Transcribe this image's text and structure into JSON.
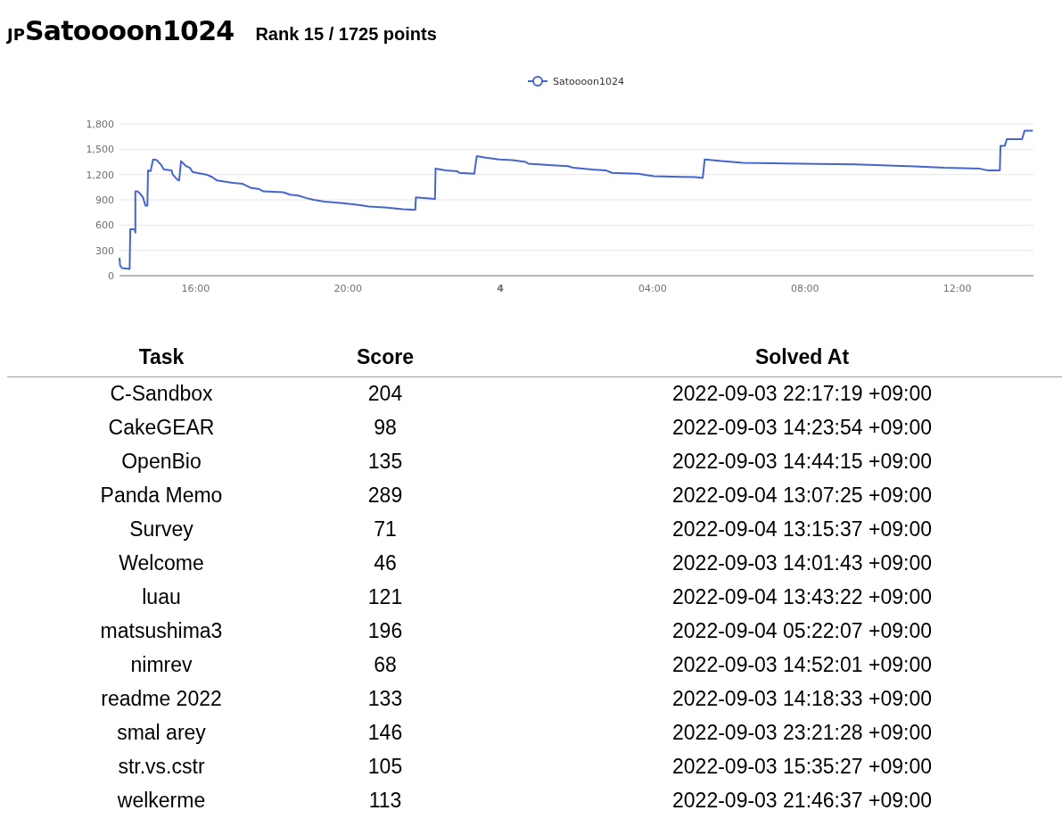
{
  "header": {
    "country": "JP",
    "username": "Satoooon1024",
    "rank": "Rank 15 / 1725 points"
  },
  "chart": {
    "chart_data": {
      "type": "line",
      "grid": true,
      "xlim": [
        "2022-09-03T14:00",
        "2022-09-04T14:00"
      ],
      "ylim": [
        0,
        1800
      ],
      "xticks": [
        {
          "value": "2022-09-03T16:00",
          "label": "16:00"
        },
        {
          "value": "2022-09-03T20:00",
          "label": "20:00"
        },
        {
          "value": "2022-09-04T00:00",
          "label": "4"
        },
        {
          "value": "2022-09-04T04:00",
          "label": "04:00"
        },
        {
          "value": "2022-09-04T08:00",
          "label": "08:00"
        },
        {
          "value": "2022-09-04T12:00",
          "label": "12:00"
        }
      ],
      "yticks": [
        {
          "value": 0,
          "label": "0"
        },
        {
          "value": 300,
          "label": "300"
        },
        {
          "value": 600,
          "label": "600"
        },
        {
          "value": 900,
          "label": "900"
        },
        {
          "value": 1200,
          "label": "1,200"
        },
        {
          "value": 1500,
          "label": "1,500"
        },
        {
          "value": 1800,
          "label": "1,800"
        }
      ],
      "x": [
        "2022-09-03T14:00",
        "2022-09-03T14:01",
        "2022-09-03T14:04",
        "2022-09-03T14:16",
        "2022-09-03T14:17",
        "2022-09-03T14:24",
        "2022-09-03T14:25",
        "2022-09-03T14:25",
        "2022-09-03T14:29",
        "2022-09-03T14:34",
        "2022-09-03T14:37",
        "2022-09-03T14:41",
        "2022-09-03T14:44",
        "2022-09-03T14:45",
        "2022-09-03T14:49",
        "2022-09-03T14:53",
        "2022-09-03T14:59",
        "2022-09-03T15:05",
        "2022-09-03T15:10",
        "2022-09-03T15:22",
        "2022-09-03T15:24",
        "2022-09-03T15:31",
        "2022-09-03T15:34",
        "2022-09-03T15:37",
        "2022-09-03T15:45",
        "2022-09-03T15:51",
        "2022-09-03T15:55",
        "2022-09-03T16:09",
        "2022-09-03T16:17",
        "2022-09-03T16:26",
        "2022-09-03T16:34",
        "2022-09-03T16:59",
        "2022-09-03T17:14",
        "2022-09-03T17:28",
        "2022-09-03T17:39",
        "2022-09-03T17:47",
        "2022-09-03T18:18",
        "2022-09-03T18:29",
        "2022-09-03T18:42",
        "2022-09-03T18:55",
        "2022-09-03T19:06",
        "2022-09-03T19:23",
        "2022-09-03T19:52",
        "2022-09-03T20:17",
        "2022-09-03T20:33",
        "2022-09-03T20:58",
        "2022-09-03T21:26",
        "2022-09-03T21:46",
        "2022-09-03T21:47",
        "2022-09-03T22:00",
        "2022-09-03T22:17",
        "2022-09-03T22:18",
        "2022-09-03T22:34",
        "2022-09-03T22:52",
        "2022-09-03T22:56",
        "2022-09-03T23:19",
        "2022-09-03T23:23",
        "2022-09-03T23:37",
        "2022-09-03T23:58",
        "2022-09-04T00:19",
        "2022-09-04T00:40",
        "2022-09-04T00:44",
        "2022-09-04T01:22",
        "2022-09-04T01:47",
        "2022-09-04T01:55",
        "2022-09-04T02:25",
        "2022-09-04T02:46",
        "2022-09-04T02:56",
        "2022-09-04T03:37",
        "2022-09-04T04:02",
        "2022-09-04T05:07",
        "2022-09-04T05:19",
        "2022-09-04T05:22",
        "2022-09-04T05:49",
        "2022-09-04T06:22",
        "2022-09-04T07:55",
        "2022-09-04T09:19",
        "2022-09-04T10:44",
        "2022-09-04T11:40",
        "2022-09-04T12:36",
        "2022-09-04T12:47",
        "2022-09-04T13:07",
        "2022-09-04T13:08",
        "2022-09-04T13:15",
        "2022-09-04T13:18",
        "2022-09-04T13:42",
        "2022-09-04T13:46",
        "2022-09-04T13:59"
      ],
      "series": [
        {
          "name": "Satoooon1024",
          "color": "#4466cc",
          "values": [
            210,
            120,
            90,
            80,
            550,
            550,
            510,
            1000,
            1000,
            960,
            930,
            830,
            830,
            1250,
            1240,
            1380,
            1370,
            1320,
            1260,
            1250,
            1200,
            1140,
            1130,
            1360,
            1300,
            1280,
            1230,
            1210,
            1200,
            1170,
            1130,
            1100,
            1090,
            1040,
            1030,
            1000,
            990,
            960,
            950,
            920,
            900,
            880,
            860,
            840,
            820,
            810,
            790,
            780,
            930,
            920,
            910,
            1270,
            1250,
            1240,
            1220,
            1210,
            1420,
            1400,
            1380,
            1370,
            1350,
            1330,
            1310,
            1300,
            1280,
            1260,
            1250,
            1220,
            1210,
            1180,
            1170,
            1160,
            1380,
            1360,
            1340,
            1330,
            1320,
            1300,
            1280,
            1270,
            1250,
            1250,
            1540,
            1540,
            1620,
            1620,
            1720,
            1720
          ]
        }
      ]
    }
  },
  "table": {
    "columns": [
      "Task",
      "Score",
      "Solved At"
    ],
    "rows": [
      [
        "C-Sandbox",
        "204",
        "2022-09-03 22:17:19 +09:00"
      ],
      [
        "CakeGEAR",
        "98",
        "2022-09-03 14:23:54 +09:00"
      ],
      [
        "OpenBio",
        "135",
        "2022-09-03 14:44:15 +09:00"
      ],
      [
        "Panda Memo",
        "289",
        "2022-09-04 13:07:25 +09:00"
      ],
      [
        "Survey",
        "71",
        "2022-09-04 13:15:37 +09:00"
      ],
      [
        "Welcome",
        "46",
        "2022-09-03 14:01:43 +09:00"
      ],
      [
        "luau",
        "121",
        "2022-09-04 13:43:22 +09:00"
      ],
      [
        "matsushima3",
        "196",
        "2022-09-04 05:22:07 +09:00"
      ],
      [
        "nimrev",
        "68",
        "2022-09-03 14:52:01 +09:00"
      ],
      [
        "readme 2022",
        "133",
        "2022-09-03 14:18:33 +09:00"
      ],
      [
        "smal arey",
        "146",
        "2022-09-03 23:21:28 +09:00"
      ],
      [
        "str.vs.cstr",
        "105",
        "2022-09-03 15:35:27 +09:00"
      ],
      [
        "welkerme",
        "113",
        "2022-09-03 21:46:37 +09:00"
      ]
    ]
  }
}
